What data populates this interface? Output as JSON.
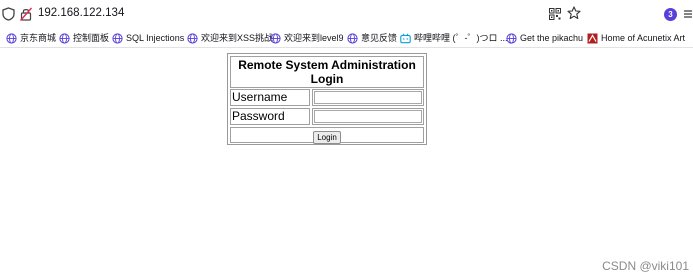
{
  "browser": {
    "url": "192.168.122.134",
    "extension_badge_count": "3",
    "accent_color": "#5b3fd9"
  },
  "bookmarks": [
    {
      "label": "京东商城",
      "icon": "globe-icon"
    },
    {
      "label": "控制面板",
      "icon": "globe-icon"
    },
    {
      "label": "SQL Injections",
      "icon": "globe-icon"
    },
    {
      "label": "欢迎来到XSS挑战",
      "icon": "globe-icon"
    },
    {
      "label": "欢迎来到level9",
      "icon": "globe-icon"
    },
    {
      "label": "意见反馈",
      "icon": "globe-icon"
    },
    {
      "label": "哔哩哔哩 (゜-゜)つロ ...",
      "icon": "bilibili-icon"
    },
    {
      "label": "Get the pikachu",
      "icon": "globe-icon"
    },
    {
      "label": "Home of Acunetix Art",
      "icon": "acunetix-icon"
    }
  ],
  "login_form": {
    "title": "Remote System Administration Login",
    "username_label": "Username",
    "username_value": "",
    "password_label": "Password",
    "password_value": "",
    "submit_label": "Login"
  },
  "watermark": "CSDN @viki101"
}
